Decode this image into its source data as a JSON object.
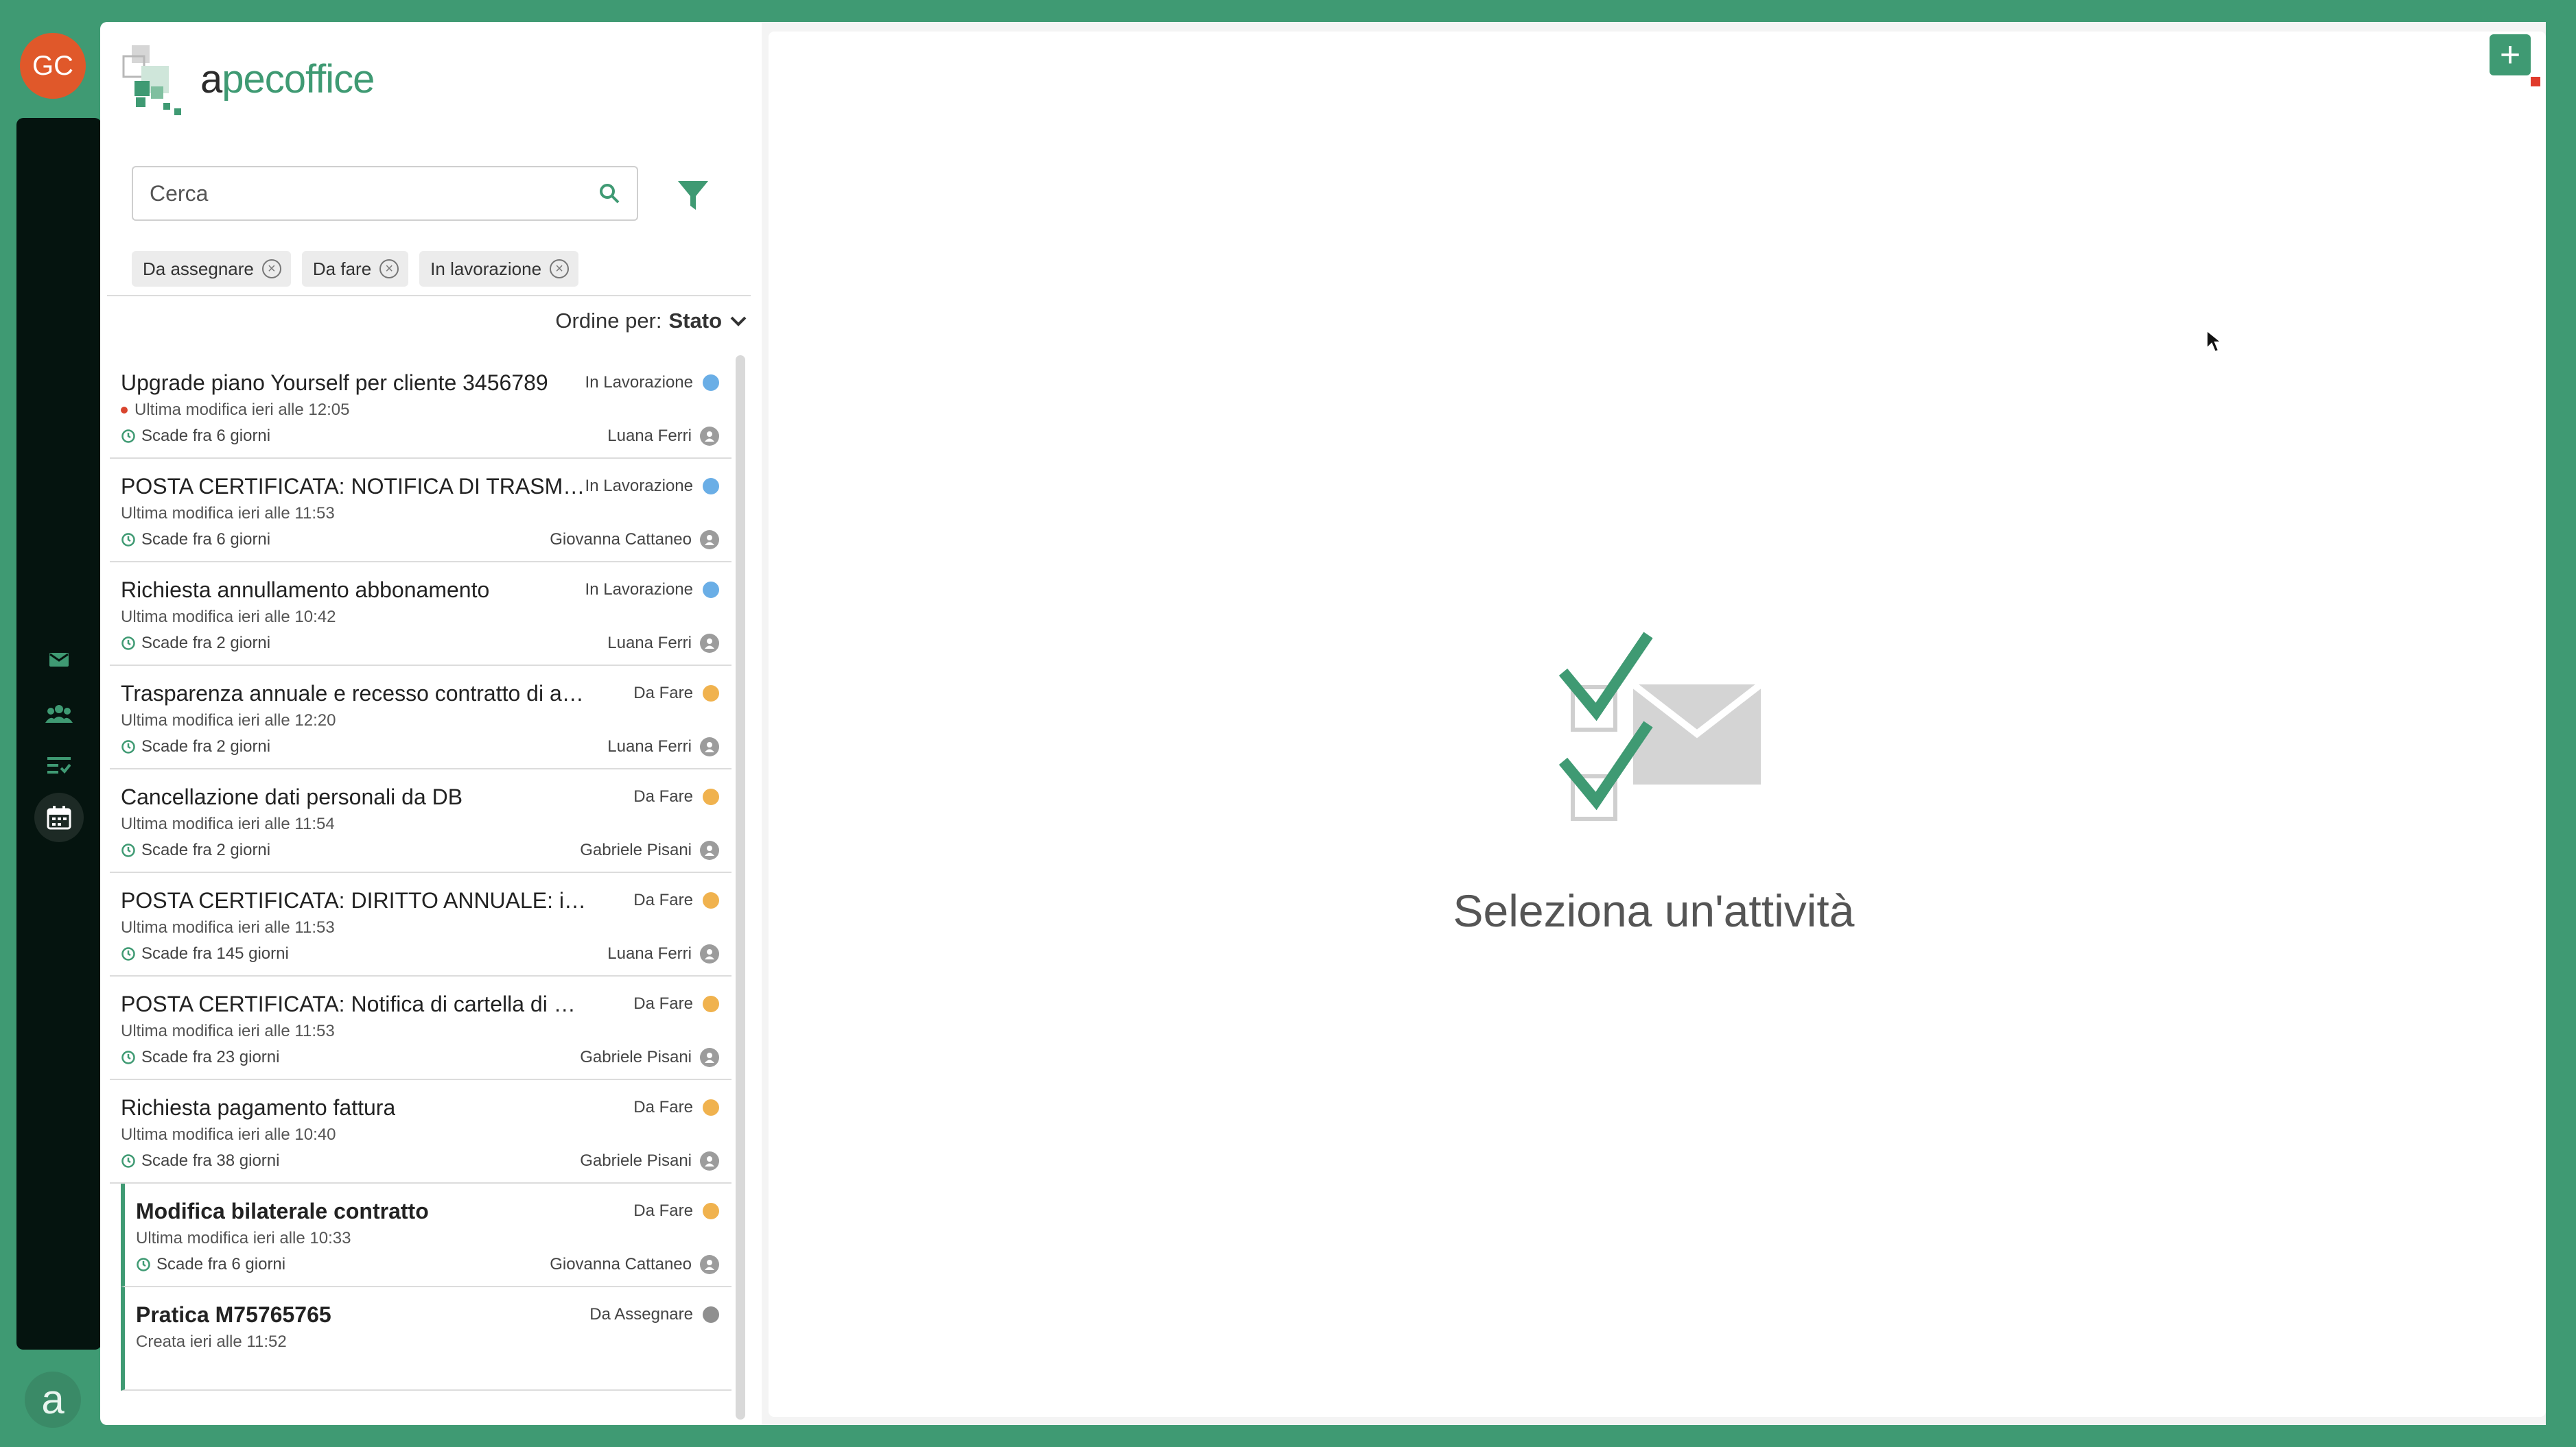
{
  "user": {
    "initials": "GC"
  },
  "brand": {
    "name_prefix": "a",
    "name_suffix": "pecoffice"
  },
  "search": {
    "placeholder": "Cerca"
  },
  "filters": [
    {
      "label": "Da assegnare"
    },
    {
      "label": "Da fare"
    },
    {
      "label": "In lavorazione"
    }
  ],
  "sort": {
    "label": "Ordine per:",
    "value": "Stato"
  },
  "status_colors": {
    "In Lavorazione": "#6aaee6",
    "Da Fare": "#f0b24e",
    "Da Assegnare": "#8f8f8f"
  },
  "items": [
    {
      "title": "Upgrade piano Yourself per cliente 3456789",
      "status": "In Lavorazione",
      "modified": "Ultima modifica ieri alle 12:05",
      "due": "Scade fra 6 giorni",
      "owner": "Luana Ferri",
      "unread_dot": true
    },
    {
      "title": "POSTA CERTIFICATA: NOTIFICA DI TRASMISSIONE",
      "status": "In Lavorazione",
      "modified": "Ultima modifica ieri alle 11:53",
      "due": "Scade fra 6 giorni",
      "owner": "Giovanna Cattaneo"
    },
    {
      "title": "Richiesta annullamento abbonamento",
      "status": "In Lavorazione",
      "modified": "Ultima modifica ieri alle 10:42",
      "due": "Scade fra 2 giorni",
      "owner": "Luana Ferri"
    },
    {
      "title": "Trasparenza annuale e recesso contratto di affiliazione",
      "status": "Da Fare",
      "modified": "Ultima modifica ieri alle 12:20",
      "due": "Scade fra 2 giorni",
      "owner": "Luana Ferri"
    },
    {
      "title": "Cancellazione dati personali da DB",
      "status": "Da Fare",
      "modified": "Ultima modifica ieri alle 11:54",
      "due": "Scade fra 2 giorni",
      "owner": "Gabriele Pisani"
    },
    {
      "title": "POSTA CERTIFICATA: DIRITTO ANNUALE: informazioni",
      "status": "Da Fare",
      "modified": "Ultima modifica ieri alle 11:53",
      "due": "Scade fra 145 giorni",
      "owner": "Luana Ferri"
    },
    {
      "title": "POSTA CERTIFICATA: Notifica di cartella di pagamento",
      "status": "Da Fare",
      "modified": "Ultima modifica ieri alle 11:53",
      "due": "Scade fra 23 giorni",
      "owner": "Gabriele Pisani"
    },
    {
      "title": "Richiesta pagamento fattura",
      "status": "Da Fare",
      "modified": "Ultima modifica ieri alle 10:40",
      "due": "Scade fra 38 giorni",
      "owner": "Gabriele Pisani"
    },
    {
      "title": "Modifica bilaterale contratto",
      "status": "Da Fare",
      "modified": "Ultima modifica ieri alle 10:33",
      "due": "Scade fra 6 giorni",
      "owner": "Giovanna Cattaneo",
      "unread": true
    },
    {
      "title": "Pratica M75765765",
      "status": "Da Assegnare",
      "modified": "Creata ieri alle 11:52",
      "unread": true
    }
  ],
  "empty_state": {
    "title": "Seleziona un'attività"
  },
  "rail_icons": [
    "mail-icon",
    "team-icon",
    "list-icon",
    "calendar-icon"
  ]
}
